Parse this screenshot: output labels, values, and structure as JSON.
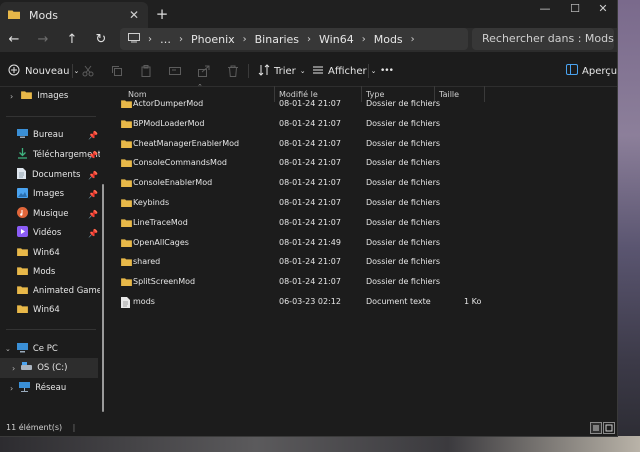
{
  "window": {
    "tab_title": "Mods",
    "new_tab": "+",
    "minimize": "—",
    "maximize": "☐",
    "close": "✕"
  },
  "address": {
    "more": "›",
    "overflow": "…",
    "crumbs": [
      "Phoenix",
      "Binaries",
      "Win64",
      "Mods"
    ],
    "search_placeholder": "Rechercher dans : Mods"
  },
  "toolbar": {
    "new_label": "Nouveau",
    "sort_label": "Trier",
    "view_label": "Afficher",
    "more_label": "•••",
    "preview_label": "Aperçu"
  },
  "sidebar": {
    "top_item": "Images",
    "quick": [
      {
        "label": "Bureau",
        "pinned": true
      },
      {
        "label": "Téléchargements",
        "pinned": true
      },
      {
        "label": "Documents",
        "pinned": true
      },
      {
        "label": "Images",
        "pinned": true
      },
      {
        "label": "Musique",
        "pinned": true
      },
      {
        "label": "Vidéos",
        "pinned": true
      },
      {
        "label": "Win64",
        "pinned": false
      },
      {
        "label": "Mods",
        "pinned": false
      },
      {
        "label": "Animated Game Timer",
        "pinned": false
      },
      {
        "label": "Win64",
        "pinned": false
      }
    ],
    "this_pc": "Ce PC",
    "drive": "OS (C:)",
    "network": "Réseau"
  },
  "columns": {
    "name": "Nom",
    "modified": "Modifié le",
    "type": "Type",
    "size": "Taille"
  },
  "files": [
    {
      "name": "ActorDumperMod",
      "modified": "08-01-24 21:07",
      "type": "Dossier de fichiers",
      "size": "",
      "kind": "folder"
    },
    {
      "name": "BPModLoaderMod",
      "modified": "08-01-24 21:07",
      "type": "Dossier de fichiers",
      "size": "",
      "kind": "folder"
    },
    {
      "name": "CheatManagerEnablerMod",
      "modified": "08-01-24 21:07",
      "type": "Dossier de fichiers",
      "size": "",
      "kind": "folder"
    },
    {
      "name": "ConsoleCommandsMod",
      "modified": "08-01-24 21:07",
      "type": "Dossier de fichiers",
      "size": "",
      "kind": "folder"
    },
    {
      "name": "ConsoleEnablerMod",
      "modified": "08-01-24 21:07",
      "type": "Dossier de fichiers",
      "size": "",
      "kind": "folder"
    },
    {
      "name": "Keybinds",
      "modified": "08-01-24 21:07",
      "type": "Dossier de fichiers",
      "size": "",
      "kind": "folder"
    },
    {
      "name": "LineTraceMod",
      "modified": "08-01-24 21:07",
      "type": "Dossier de fichiers",
      "size": "",
      "kind": "folder"
    },
    {
      "name": "OpenAllCages",
      "modified": "08-01-24 21:49",
      "type": "Dossier de fichiers",
      "size": "",
      "kind": "folder"
    },
    {
      "name": "shared",
      "modified": "08-01-24 21:07",
      "type": "Dossier de fichiers",
      "size": "",
      "kind": "folder"
    },
    {
      "name": "SplitScreenMod",
      "modified": "08-01-24 21:07",
      "type": "Dossier de fichiers",
      "size": "",
      "kind": "folder"
    },
    {
      "name": "mods",
      "modified": "06-03-23 02:12",
      "type": "Document texte",
      "size": "1 Ko",
      "kind": "file"
    }
  ],
  "status": {
    "count": "11 élément(s)",
    "sep": "|"
  },
  "colors": {
    "folder": "#e8b849",
    "accent": "#4aa3f0"
  }
}
